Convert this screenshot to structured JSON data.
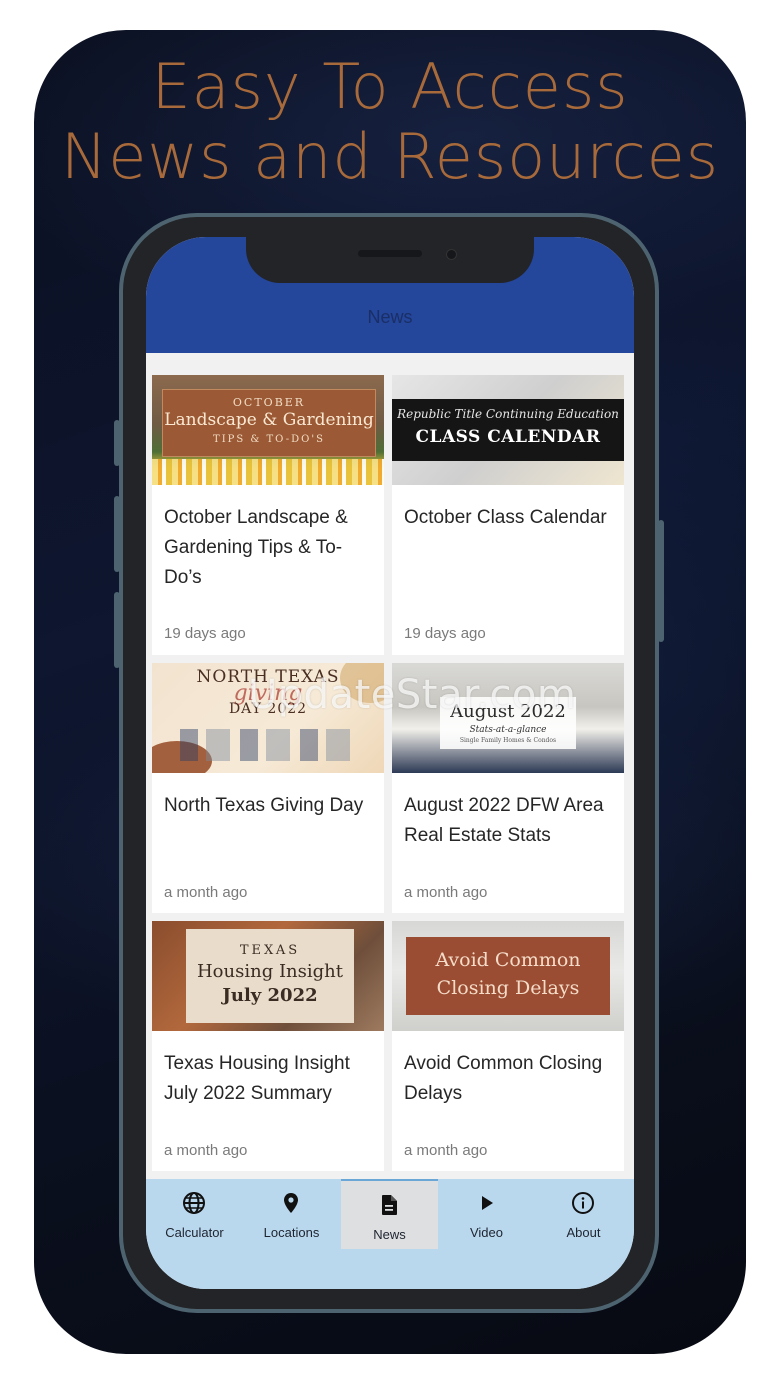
{
  "promo": {
    "headline_line1": "Easy To Access",
    "headline_line2": "News and Resources"
  },
  "app": {
    "header_title": "News",
    "accent_color": "#24469b",
    "tabbar_color": "#b9d8ee"
  },
  "articles": [
    {
      "title": "October Landscape & Gardening Tips & To-Do’s",
      "time": "19 days ago",
      "thumb": {
        "line1": "OCTOBER",
        "line2": "Landscape & Gardening",
        "line3": "TIPS & TO-DO'S"
      }
    },
    {
      "title": "October Class Calendar",
      "time": "19 days ago",
      "thumb": {
        "line1": "Republic Title Continuing Education",
        "line2": "CLASS CALENDAR"
      }
    },
    {
      "title": "North Texas Giving Day",
      "time": "a month ago",
      "thumb": {
        "line1": "NORTH TEXAS",
        "line2": "giving",
        "line3": "DAY 2022"
      }
    },
    {
      "title": "August 2022 DFW Area Real Estate Stats",
      "time": "a month ago",
      "thumb": {
        "line1": "August 2022",
        "line2": "Stats-at-a-glance",
        "line3": "Single Family Homes & Condos"
      }
    },
    {
      "title": "Texas Housing Insight July 2022 Summary",
      "time": "a month ago",
      "thumb": {
        "line1": "TEXAS",
        "line2": "Housing Insight",
        "line3": "July 2022"
      }
    },
    {
      "title": "Avoid Common Closing Delays",
      "time": "a month ago",
      "thumb": {
        "line1": "Avoid Common",
        "line2": "Closing Delays"
      }
    }
  ],
  "tabs": [
    {
      "label": "Calculator",
      "icon": "globe-icon"
    },
    {
      "label": "Locations",
      "icon": "map-pin-icon"
    },
    {
      "label": "News",
      "icon": "document-icon",
      "active": true
    },
    {
      "label": "Video",
      "icon": "play-icon"
    },
    {
      "label": "About",
      "icon": "info-icon"
    }
  ],
  "watermark": "UpdateStar.com"
}
